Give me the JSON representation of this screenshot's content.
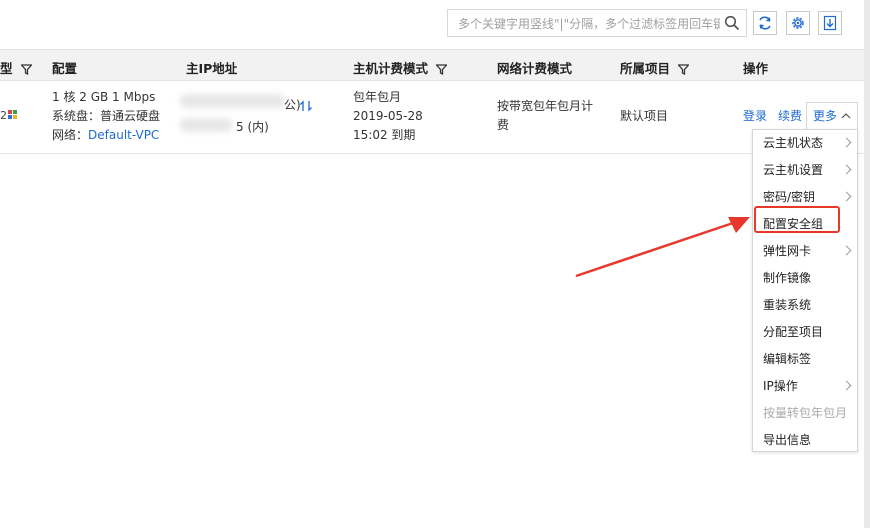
{
  "toolbar": {
    "search_placeholder": "多个关键字用竖线\"|\"分隔，多个过滤标签用回车键分隔"
  },
  "table": {
    "columns": [
      {
        "label": "型",
        "filter": true
      },
      {
        "label": "配置",
        "filter": false
      },
      {
        "label": "主IP地址",
        "filter": false
      },
      {
        "label": "主机计费模式",
        "filter": true
      },
      {
        "label": "网络计费模式",
        "filter": false
      },
      {
        "label": "所属项目",
        "filter": true
      },
      {
        "label": "操作",
        "filter": false
      }
    ],
    "row": {
      "config_line1": "1 核 2 GB 1 Mbps",
      "config_line2": "系统盘：普通云硬盘",
      "network_label": "网络：",
      "network_link": "Default-VPC",
      "ip_public_suffix": "公)",
      "ip_private_suffix": "5 (内)",
      "billing_mode": "包年包月",
      "billing_date": "2019-05-28",
      "billing_expiry": "15:02 到期",
      "net_billing_line1": "按带宽包年包月计",
      "net_billing_line2": "费",
      "project": "默认项目",
      "action_login": "登录",
      "action_renew": "续费",
      "action_more": "更多"
    }
  },
  "dropdown": {
    "items": [
      {
        "label": "云主机状态",
        "submenu": true,
        "disabled": false
      },
      {
        "label": "云主机设置",
        "submenu": true,
        "disabled": false
      },
      {
        "label": "密码/密钥",
        "submenu": true,
        "disabled": false
      },
      {
        "label": "配置安全组",
        "submenu": false,
        "disabled": false,
        "highlighted": true
      },
      {
        "label": "弹性网卡",
        "submenu": true,
        "disabled": false
      },
      {
        "label": "制作镜像",
        "submenu": false,
        "disabled": false
      },
      {
        "label": "重装系统",
        "submenu": false,
        "disabled": false
      },
      {
        "label": "分配至项目",
        "submenu": false,
        "disabled": false
      },
      {
        "label": "编辑标签",
        "submenu": false,
        "disabled": false
      },
      {
        "label": "IP操作",
        "submenu": true,
        "disabled": false
      },
      {
        "label": "按量转包年包月",
        "submenu": false,
        "disabled": true
      },
      {
        "label": "导出信息",
        "submenu": false,
        "disabled": false
      }
    ]
  },
  "colors": {
    "link": "#1f6ad2",
    "annotation_red": "#e8382b",
    "header_bg": "#f2f2f2"
  }
}
